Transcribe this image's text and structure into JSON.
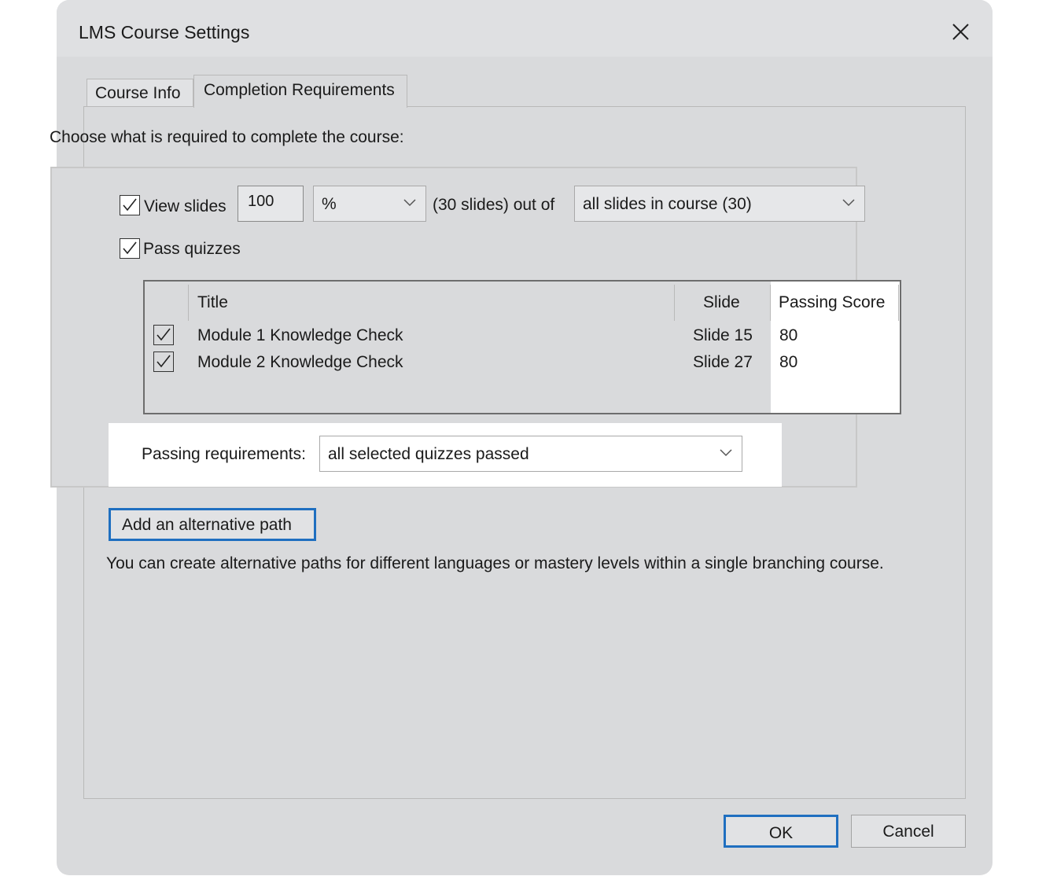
{
  "window": {
    "title": "LMS Course Settings",
    "close_icon": "close-icon"
  },
  "tabs": [
    {
      "label": "Course Info",
      "selected": false
    },
    {
      "label": "Completion Requirements",
      "selected": true
    }
  ],
  "completion": {
    "instruction": "Choose what is required to complete the course:",
    "view_slides": {
      "checked": true,
      "label": "View slides",
      "amount": "100",
      "unit": "%",
      "count_text": "(30 slides) out of",
      "scope": "all slides in course (30)"
    },
    "pass_quizzes": {
      "checked": true,
      "label": "Pass quizzes"
    },
    "quiz_table": {
      "headers": [
        "Title",
        "Slide",
        "Passing Score"
      ],
      "rows": [
        {
          "checked": true,
          "title": "Module 1 Knowledge Check",
          "slide": "Slide 15",
          "score": "80"
        },
        {
          "checked": true,
          "title": "Module 2 Knowledge Check",
          "slide": "Slide 27",
          "score": "80"
        }
      ]
    },
    "passing_requirements": {
      "label": "Passing requirements:",
      "value": "all selected quizzes passed"
    },
    "alternative_path": {
      "button_label": "Add an alternative path",
      "hint": "You can create alternative paths for different languages or mastery levels within a single branching course."
    }
  },
  "buttons": {
    "ok": "OK",
    "cancel": "Cancel"
  },
  "colors": {
    "dialog_bg": "#d9dadc",
    "focus_border": "#1f6fc0"
  }
}
